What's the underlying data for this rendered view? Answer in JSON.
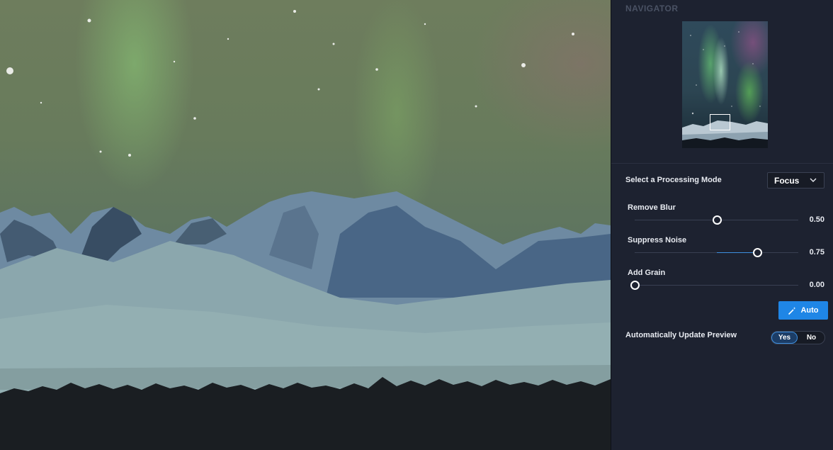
{
  "navigator": {
    "title": "NAVIGATOR"
  },
  "processing_mode": {
    "label": "Select a Processing Mode",
    "selected": "Focus"
  },
  "sliders": [
    {
      "label": "Remove Blur",
      "value": "0.50",
      "fraction": 0.5
    },
    {
      "label": "Suppress Noise",
      "value": "0.75",
      "fraction": 0.75
    },
    {
      "label": "Add Grain",
      "value": "0.00",
      "fraction": 0.0
    }
  ],
  "auto_button": {
    "label": "Auto",
    "icon": "magic-wand-icon"
  },
  "auto_update": {
    "label": "Automatically Update Preview",
    "options": [
      "Yes",
      "No"
    ],
    "selected": "Yes"
  },
  "colors": {
    "accent": "#1f86e6",
    "panel_bg": "#1d2230",
    "slider_fill": "#3d8fe0"
  }
}
